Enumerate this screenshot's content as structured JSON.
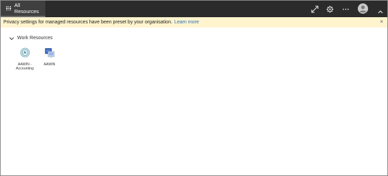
{
  "header": {
    "tab_label": "All Resources",
    "icons": [
      "grid-icon",
      "expand-icon",
      "gear-icon",
      "more-icon",
      "avatar",
      "chevron-up-icon"
    ]
  },
  "banner": {
    "message": "Privacy settings for managed resources have been preset by your organisation.",
    "link_text": "Learn more",
    "close_symbol": "×",
    "background": "#fff4ce",
    "link_color": "#2a6fb6"
  },
  "work_resources": {
    "section_title": "Work Resources",
    "items": [
      {
        "label": "AAWIN - Accounting",
        "icon": "remote-app-icon"
      },
      {
        "label": "AAWIN",
        "icon": "remote-desktop-icon"
      }
    ]
  },
  "colors": {
    "topbar": "#2b2b2b",
    "active_tab": "#3f3f3f"
  }
}
